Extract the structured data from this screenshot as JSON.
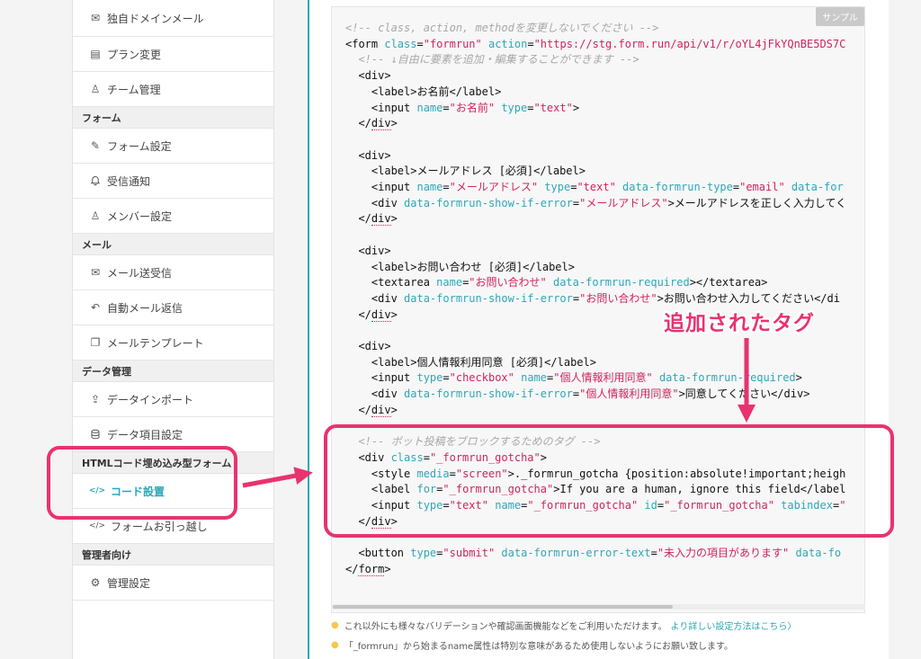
{
  "sidebar": {
    "top_items": [
      {
        "icon": "mail-icon",
        "glyph": "✉",
        "label": "独自ドメインメール"
      },
      {
        "icon": "document-icon",
        "glyph": "▤",
        "label": "プラン変更"
      },
      {
        "icon": "user-icon",
        "glyph": "♙",
        "label": "チーム管理"
      }
    ],
    "sections": [
      {
        "title": "フォーム",
        "items": [
          {
            "icon": "pencil-icon",
            "glyph": "✎",
            "label": "フォーム設定"
          },
          {
            "icon": "bell-icon",
            "glyph": "♫",
            "label": "受信通知"
          },
          {
            "icon": "user-icon",
            "glyph": "♙",
            "label": "メンバー設定"
          }
        ]
      },
      {
        "title": "メール",
        "items": [
          {
            "icon": "mail-icon",
            "glyph": "✉",
            "label": "メール送受信"
          },
          {
            "icon": "reply-icon",
            "glyph": "↶",
            "label": "自動メール返信"
          },
          {
            "icon": "copy-icon",
            "glyph": "❐",
            "label": "メールテンプレート"
          }
        ]
      },
      {
        "title": "データ管理",
        "items": [
          {
            "icon": "upload-icon",
            "glyph": "⇪",
            "label": "データインポート"
          },
          {
            "icon": "database-icon",
            "glyph": "☰",
            "label": "データ項目設定"
          }
        ]
      },
      {
        "title": "HTMLコード埋め込み型フォーム",
        "items": [
          {
            "icon": "code-icon",
            "glyph": "</>",
            "label": "コード設置",
            "active": true
          },
          {
            "icon": "code-icon",
            "glyph": "</>",
            "label": "フォームお引っ越し"
          }
        ]
      },
      {
        "title": "管理者向け",
        "items": [
          {
            "icon": "gear-icon",
            "glyph": "⚙",
            "label": "管理設定"
          }
        ]
      }
    ]
  },
  "code_panel": {
    "badge": "サンプル",
    "lines": {
      "l1": "<!-- class, action, methodを変更しないでください -->",
      "l3": "<!-- ↓自由に要素を追加・編集することができます -->",
      "bot_comment": "<!-- ボット投稿をブロックするためのタグ -->"
    },
    "text": {
      "name_label": "お名前",
      "email_label": "メールアドレス [必須]",
      "email_error": "メールアドレスを正しく入力してく",
      "inquiry_label": "お問い合わせ [必須]",
      "inquiry_error": "お問い合わせ入力してください</di",
      "privacy_label": "個人情報利用同意 [必須]",
      "privacy_error": "同意してください",
      "gotcha_label": "If you are a human, ignore this field"
    },
    "values": {
      "form_class": "\"formrun\"",
      "form_action": "\"https://stg.form.run/api/v1/r/oYL4jFkYQnBE5DS7C",
      "name_attr": "\"お名前\"",
      "email_attr": "\"メールアドレス\"",
      "inquiry_attr": "\"お問い合わせ\"",
      "privacy_attr": "\"個人情報利用同意\"",
      "gotcha_class": "\"_formrun_gotcha\"",
      "gotcha_style": "._formrun_gotcha {position:absolute!important;heigh",
      "error_text": "\"未入力の項目があります\""
    }
  },
  "notes": {
    "note1": "これ以外にも様々なバリデーションや確認画面機能などをご利用いただけます。",
    "note1_link": "より詳しい設定方法はこちら〉",
    "note2": "「_formrun」から始まるname属性は特別な意味があるため使用しないようにお願い致します。"
  },
  "annotation": {
    "label": "追加されたタグ",
    "color": "#e8336f"
  },
  "colors": {
    "accent": "#2da7b8",
    "attr_name": "#2fa7b8",
    "attr_value": "#d0245d",
    "comment": "#a8a8a8"
  }
}
